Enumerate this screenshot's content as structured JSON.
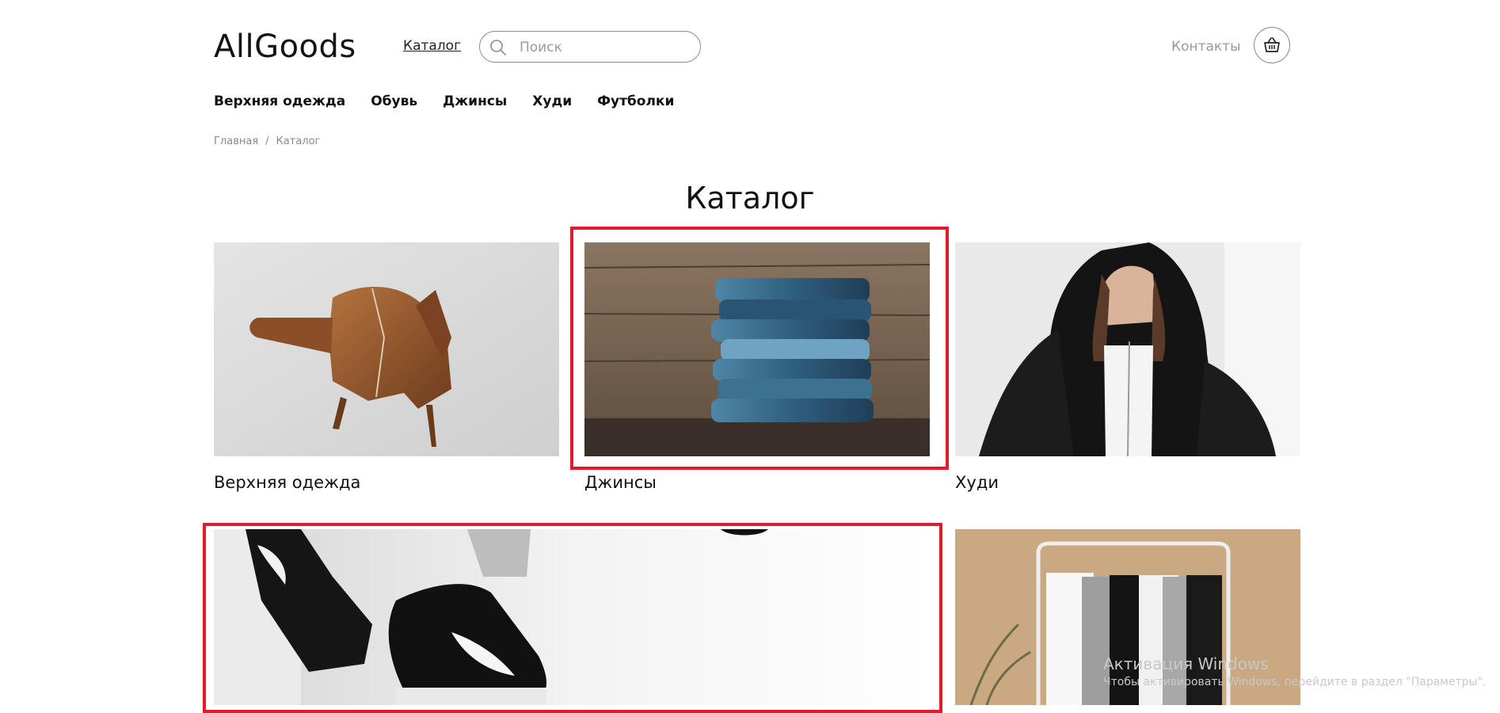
{
  "header": {
    "logo": "AllGoods",
    "nav_catalog": "Каталог",
    "search": {
      "placeholder": "Поиск",
      "value": ""
    },
    "contacts": "Контакты"
  },
  "categories_nav": [
    "Верхняя одежда",
    "Обувь",
    "Джинсы",
    "Худи",
    "Футболки"
  ],
  "breadcrumb": [
    "Главная",
    "/",
    "Каталог"
  ],
  "page_title": "Каталог",
  "tiles": [
    {
      "label": "Верхняя одежда",
      "image": "leather-jacket-photo"
    },
    {
      "label": "Джинсы",
      "image": "stacked-jeans-photo",
      "highlighted": true
    },
    {
      "label": "Худи",
      "image": "black-hoodie-photo"
    },
    {
      "label": "",
      "image": "black-sneakers-photo",
      "highlighted": true
    },
    {
      "label": "",
      "image": "tshirts-rack-photo"
    }
  ],
  "watermark": {
    "line1": "Активация Windows",
    "line2": "Чтобы активировать Windows, перейдите в раздел \"Параметры\"."
  },
  "colors": {
    "highlight": "#e21b2c",
    "text": "#111111",
    "muted": "#9a9a9a"
  },
  "icons": [
    "search-icon",
    "basket-icon"
  ]
}
